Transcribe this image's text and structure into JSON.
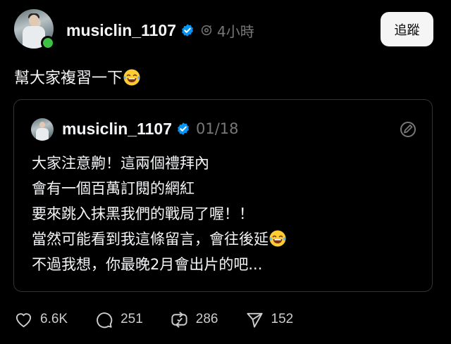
{
  "post": {
    "username": "musiclin_1107",
    "timestamp": "4小時",
    "follow_label": "追蹤",
    "text": "幫大家複習一下"
  },
  "quote": {
    "username": "musiclin_1107",
    "date": "01/18",
    "lines": [
      "大家注意齁！這兩個禮拜內",
      "會有一個百萬訂閱的網紅",
      "要來跳入抹黑我們的戰局了喔！！",
      "當然可能看到我這條留言，會往後延",
      "不過我想，你最晚2月會出片的吧..."
    ]
  },
  "actions": {
    "likes": "6.6K",
    "comments": "251",
    "reposts": "286",
    "shares": "152"
  },
  "icons": {
    "verified": "verified-badge-icon",
    "audience": "audience-icon",
    "emoji": "laughing-tears-emoji",
    "quote_menu": "quote-menu-icon",
    "like": "heart-icon",
    "comment": "comment-icon",
    "repost": "repost-icon",
    "share": "send-icon"
  },
  "colors": {
    "background": "#000000",
    "text": "#f3f5f7",
    "muted": "#777777",
    "verified": "#0095f6",
    "online": "#3ec043"
  }
}
